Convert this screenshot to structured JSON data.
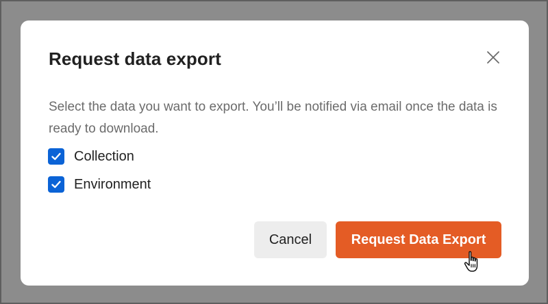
{
  "overlay": {
    "color": "#8c8c8c"
  },
  "dialog": {
    "title": "Request data export",
    "description": "Select the data you want to export. You’ll be notified via email once the data is ready to download.",
    "close_icon": "close-icon",
    "options": [
      {
        "label": "Collection",
        "checked": true
      },
      {
        "label": "Environment",
        "checked": true
      }
    ],
    "checkbox_color": "#0b63d6",
    "buttons": {
      "cancel_label": "Cancel",
      "primary_label": "Request Data Export",
      "primary_color": "#e45c25"
    }
  },
  "cursor": {
    "icon": "hand-pointer-icon"
  }
}
